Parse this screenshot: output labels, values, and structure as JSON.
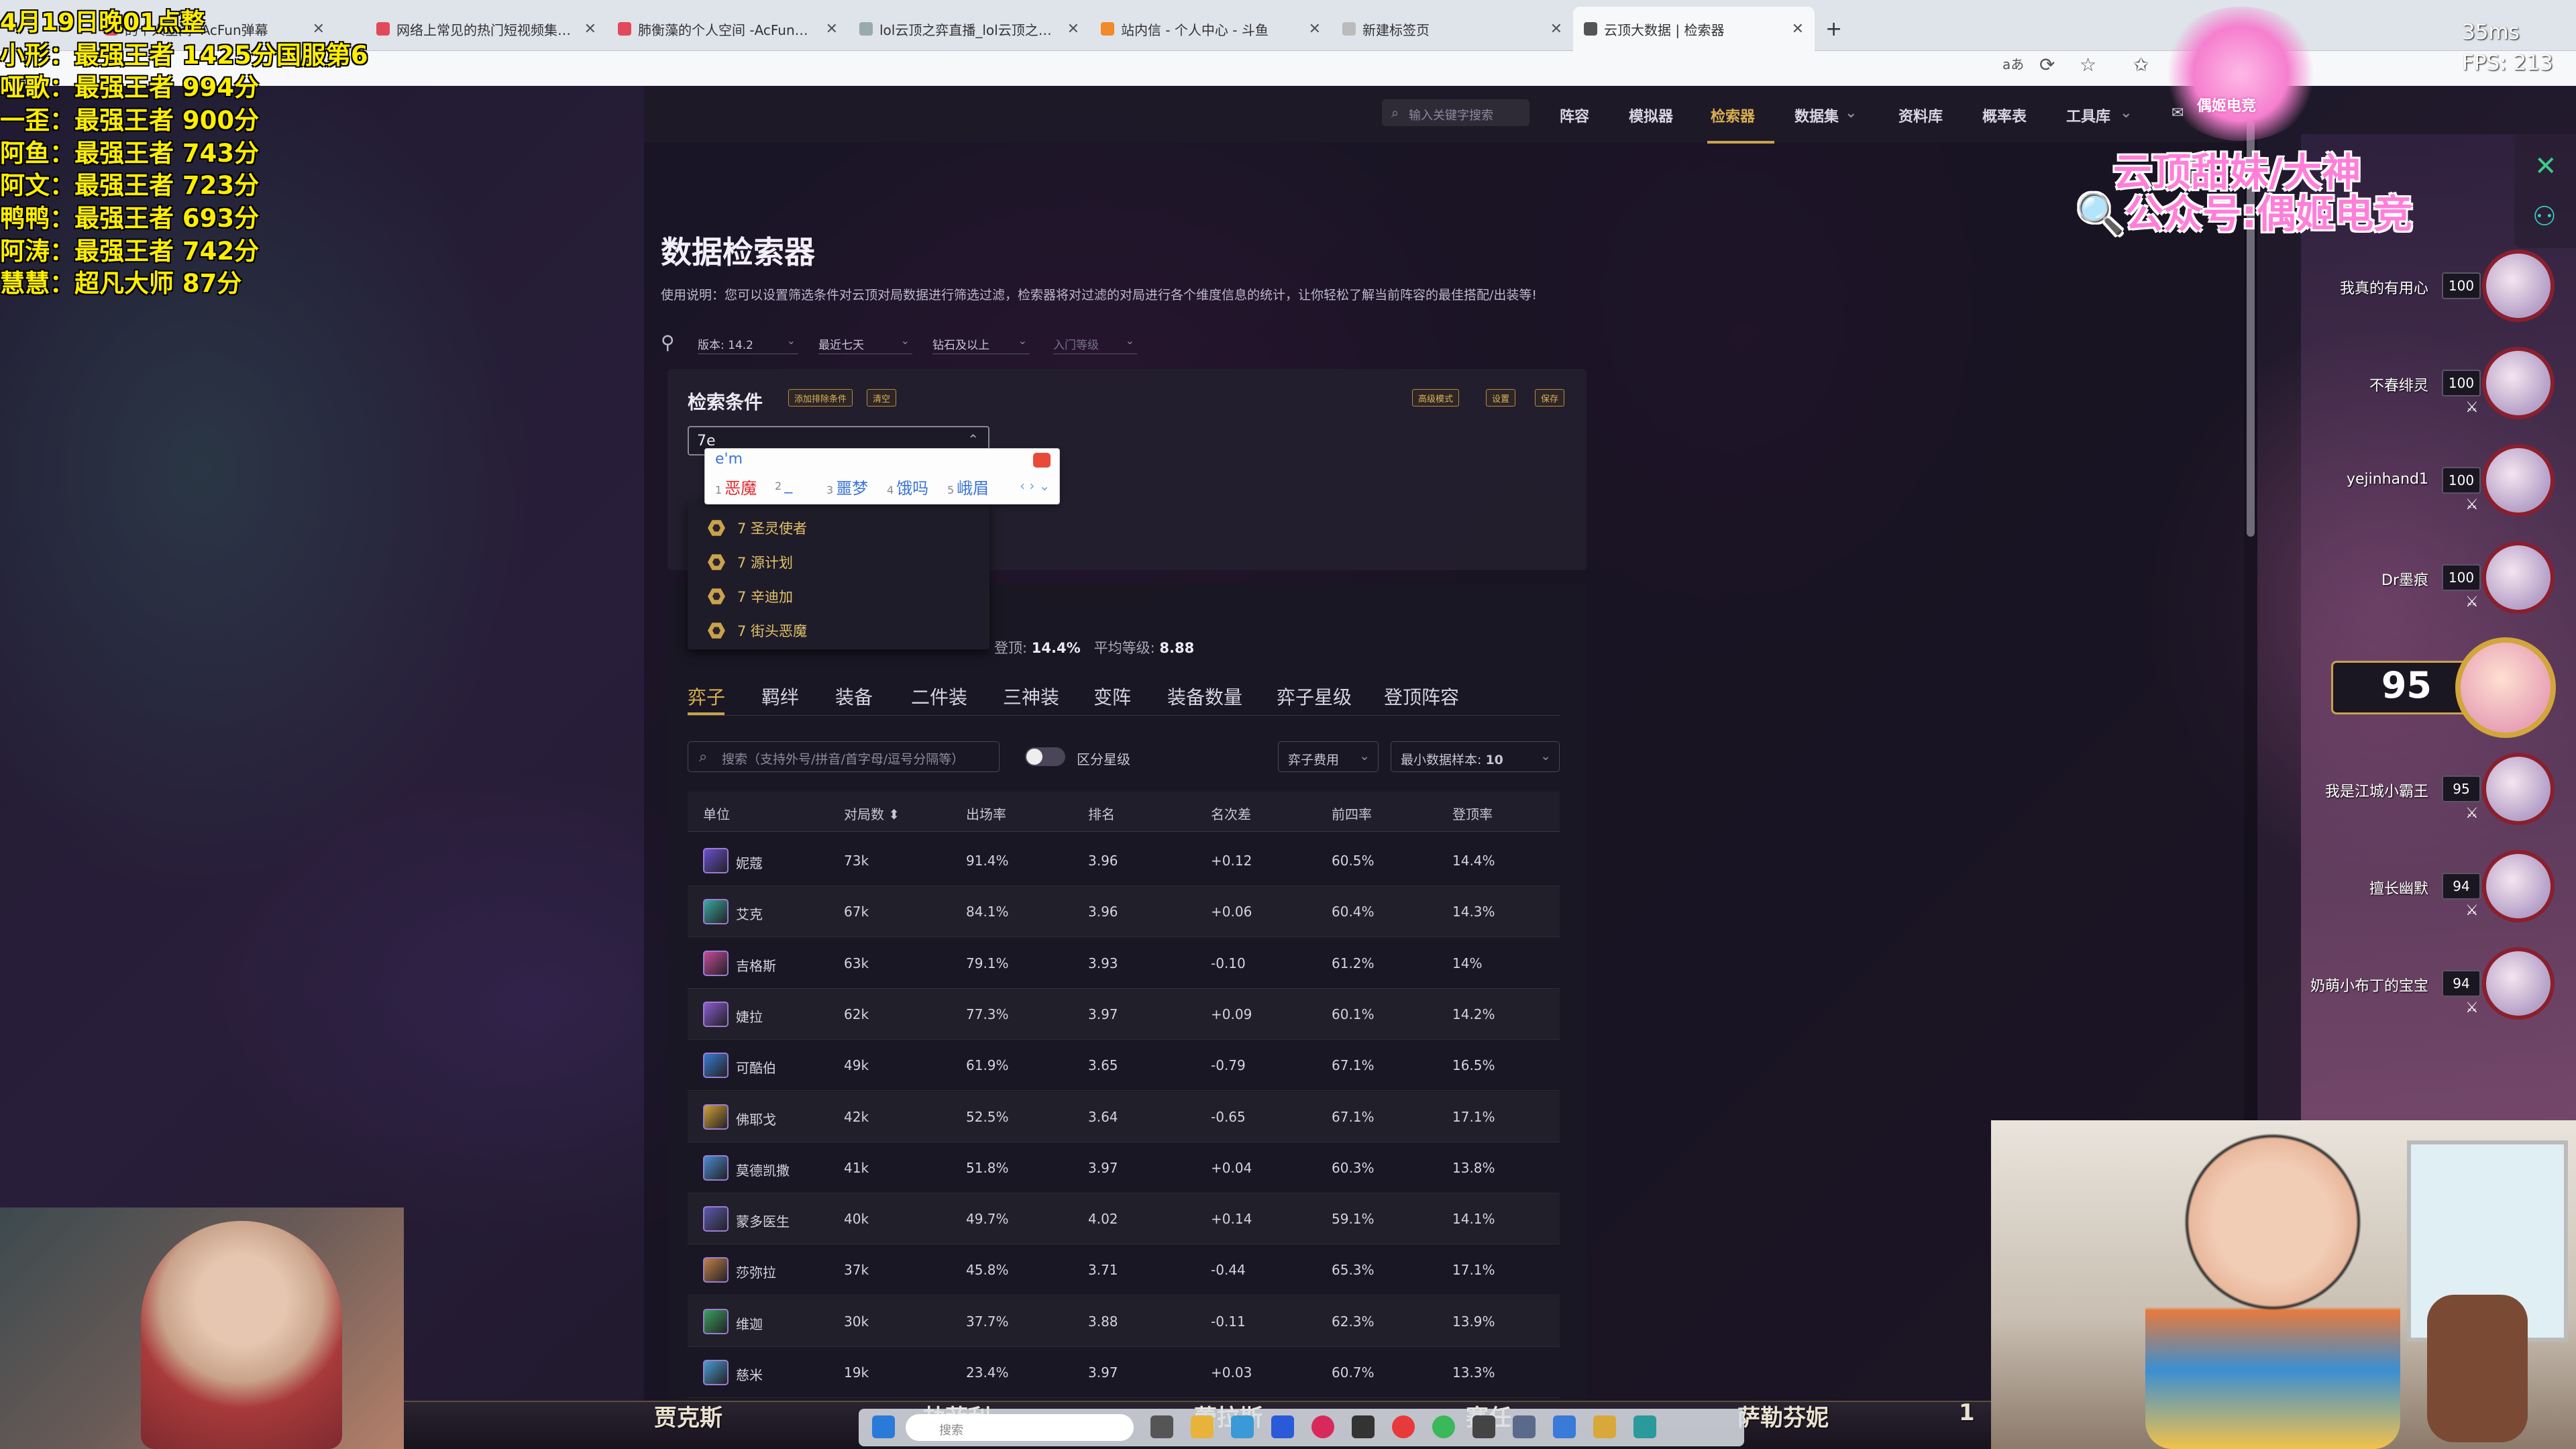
{
  "browser": {
    "tabs": [
      {
        "title": "的个人空间 -AcFun弹幕"
      },
      {
        "title": "网络上常见的热门短视频集锦 暴"
      },
      {
        "title": "肺衡藻的个人空间 -AcFun弹幕视"
      },
      {
        "title": "lol云顶之弈直播_lol云顶之弈直播"
      },
      {
        "title": "站内信 - 个人中心 - 斗鱼"
      },
      {
        "title": "新建标签页"
      },
      {
        "title": "云顶大数据 | 检索器"
      }
    ],
    "new_tab": "+",
    "toolbar_text": "aあ"
  },
  "site": {
    "search_placeholder": "输入关键字搜索",
    "nav": [
      "阵容",
      "模拟器",
      "检索器",
      "数据集",
      "资料库",
      "概率表",
      "工具库"
    ],
    "nav_active": "检索器",
    "title": "数据检索器",
    "usage": "使用说明：您可以设置筛选条件对云顶对局数据进行筛选过滤，检索器将对过滤的对局进行各个维度信息的统计，让你轻松了解当前阵容的最佳搭配/出装等!",
    "filters": [
      "版本: 14.2",
      "最近七天",
      "钻石及以上",
      "入门等级"
    ],
    "conditions": {
      "title": "检索条件",
      "add_exclude": "添加排除条件",
      "clear": "清空",
      "advanced": "高级模式",
      "settings": "设置",
      "save": "保存",
      "input_value": "7e"
    },
    "ime": {
      "composition": "e'm",
      "candidates": [
        {
          "num": "1",
          "text": "恶魔"
        },
        {
          "num": "2",
          "text": "_"
        },
        {
          "num": "3",
          "text": "噩梦"
        },
        {
          "num": "4",
          "text": "饿吗"
        },
        {
          "num": "5",
          "text": "峨眉"
        }
      ],
      "nav": "‹ › ⌄"
    },
    "dropdown": [
      "7 圣灵使者",
      "7 源计划",
      "7 辛迪加",
      "7 街头恶魔"
    ],
    "stats": {
      "top4_label": "登顶:",
      "top4_value": "14.4%",
      "avg_label": "平均等级:",
      "avg_value": "8.88"
    },
    "tabs": [
      "弈子",
      "羁绊",
      "装备",
      "二件装",
      "三神装",
      "变阵",
      "装备数量",
      "弈子星级",
      "登顶阵容"
    ],
    "unit_search_placeholder": "搜索（支持外号/拼音/首字母/逗号分隔等）",
    "toggle_label": "区分星级",
    "cost_select": "弈子费用",
    "min_sample_label": "最小数据样本:",
    "min_sample_value": "10",
    "table": {
      "headers": [
        "单位",
        "对局数",
        "出场率",
        "排名",
        "名次差",
        "前四率",
        "登顶率"
      ],
      "sort_glyph": "⬍",
      "rows": [
        {
          "name": "妮蔻",
          "games": "73k",
          "pick": "91.4%",
          "rank": "3.96",
          "diff": "+0.12",
          "top4": "60.5%",
          "win": "14.4%",
          "color": "#6a4fd0"
        },
        {
          "name": "艾克",
          "games": "67k",
          "pick": "84.1%",
          "rank": "3.96",
          "diff": "+0.06",
          "top4": "60.4%",
          "win": "14.3%",
          "color": "#3aa7a0"
        },
        {
          "name": "吉格斯",
          "games": "63k",
          "pick": "79.1%",
          "rank": "3.93",
          "diff": "-0.10",
          "top4": "61.2%",
          "win": "14%",
          "color": "#c44a9a"
        },
        {
          "name": "婕拉",
          "games": "62k",
          "pick": "77.3%",
          "rank": "3.97",
          "diff": "+0.09",
          "top4": "60.1%",
          "win": "14.2%",
          "color": "#8a5ad0"
        },
        {
          "name": "可酷伯",
          "games": "49k",
          "pick": "61.9%",
          "rank": "3.65",
          "diff": "-0.79",
          "top4": "67.1%",
          "win": "16.5%",
          "color": "#3a7ad0"
        },
        {
          "name": "佛耶戈",
          "games": "42k",
          "pick": "52.5%",
          "rank": "3.64",
          "diff": "-0.65",
          "top4": "67.1%",
          "win": "17.1%",
          "color": "#d0a03a"
        },
        {
          "name": "莫德凯撒",
          "games": "41k",
          "pick": "51.8%",
          "rank": "3.97",
          "diff": "+0.04",
          "top4": "60.3%",
          "win": "13.8%",
          "color": "#4a8ad0"
        },
        {
          "name": "蒙多医生",
          "games": "40k",
          "pick": "49.7%",
          "rank": "4.02",
          "diff": "+0.14",
          "top4": "59.1%",
          "win": "14.1%",
          "color": "#5a5ab0"
        },
        {
          "name": "莎弥拉",
          "games": "37k",
          "pick": "45.8%",
          "rank": "3.71",
          "diff": "-0.44",
          "top4": "65.3%",
          "win": "17.1%",
          "color": "#c0804a"
        },
        {
          "name": "维迦",
          "games": "30k",
          "pick": "37.7%",
          "rank": "3.88",
          "diff": "-0.11",
          "top4": "62.3%",
          "win": "13.9%",
          "color": "#3aa060"
        },
        {
          "name": "慈米",
          "games": "19k",
          "pick": "23.4%",
          "rank": "3.97",
          "diff": "+0.03",
          "top4": "60.7%",
          "win": "13.3%",
          "color": "#4a9ad0"
        }
      ]
    }
  },
  "overlay": {
    "date": "4月19日晚01点整",
    "rankings": [
      "小形：最强王者 1425分国服第6",
      "哑歌：最强王者 994分",
      "一歪：最强王者 900分",
      "阿鱼：最强王者 743分",
      "阿文：最强王者 723分",
      "鸭鸭：最强王者 693分",
      "阿涛：最强王者 742分",
      "慧慧：超凡大师 87分"
    ],
    "ms": "35ms",
    "fps": "FPS:  213",
    "streamer_line1": "云顶甜妹/大神",
    "streamer_line2": "公众号:偶姬电竞",
    "logo_text": "偶姬电竞"
  },
  "scoreboard": {
    "players": [
      {
        "name": "我真的有用心",
        "hp": "100"
      },
      {
        "name": "不春绯灵",
        "hp": "100"
      },
      {
        "name": "yejinhand1",
        "hp": "100"
      },
      {
        "name": "Dr墨痕",
        "hp": "100"
      },
      {
        "name": "我是江城小霸王",
        "hp": "95"
      },
      {
        "name": "擅长幽默",
        "hp": "94"
      },
      {
        "name": "奶萌小布丁的宝宝",
        "hp": "94"
      }
    ],
    "me_hp": "95",
    "swords": "⚔"
  },
  "hud": {
    "names": [
      "贾克斯",
      "劫菲利",
      "蕾拉斯",
      "赛任",
      "萨勒芬妮"
    ],
    "last_num": "1",
    "taskbar_search": "搜索"
  }
}
